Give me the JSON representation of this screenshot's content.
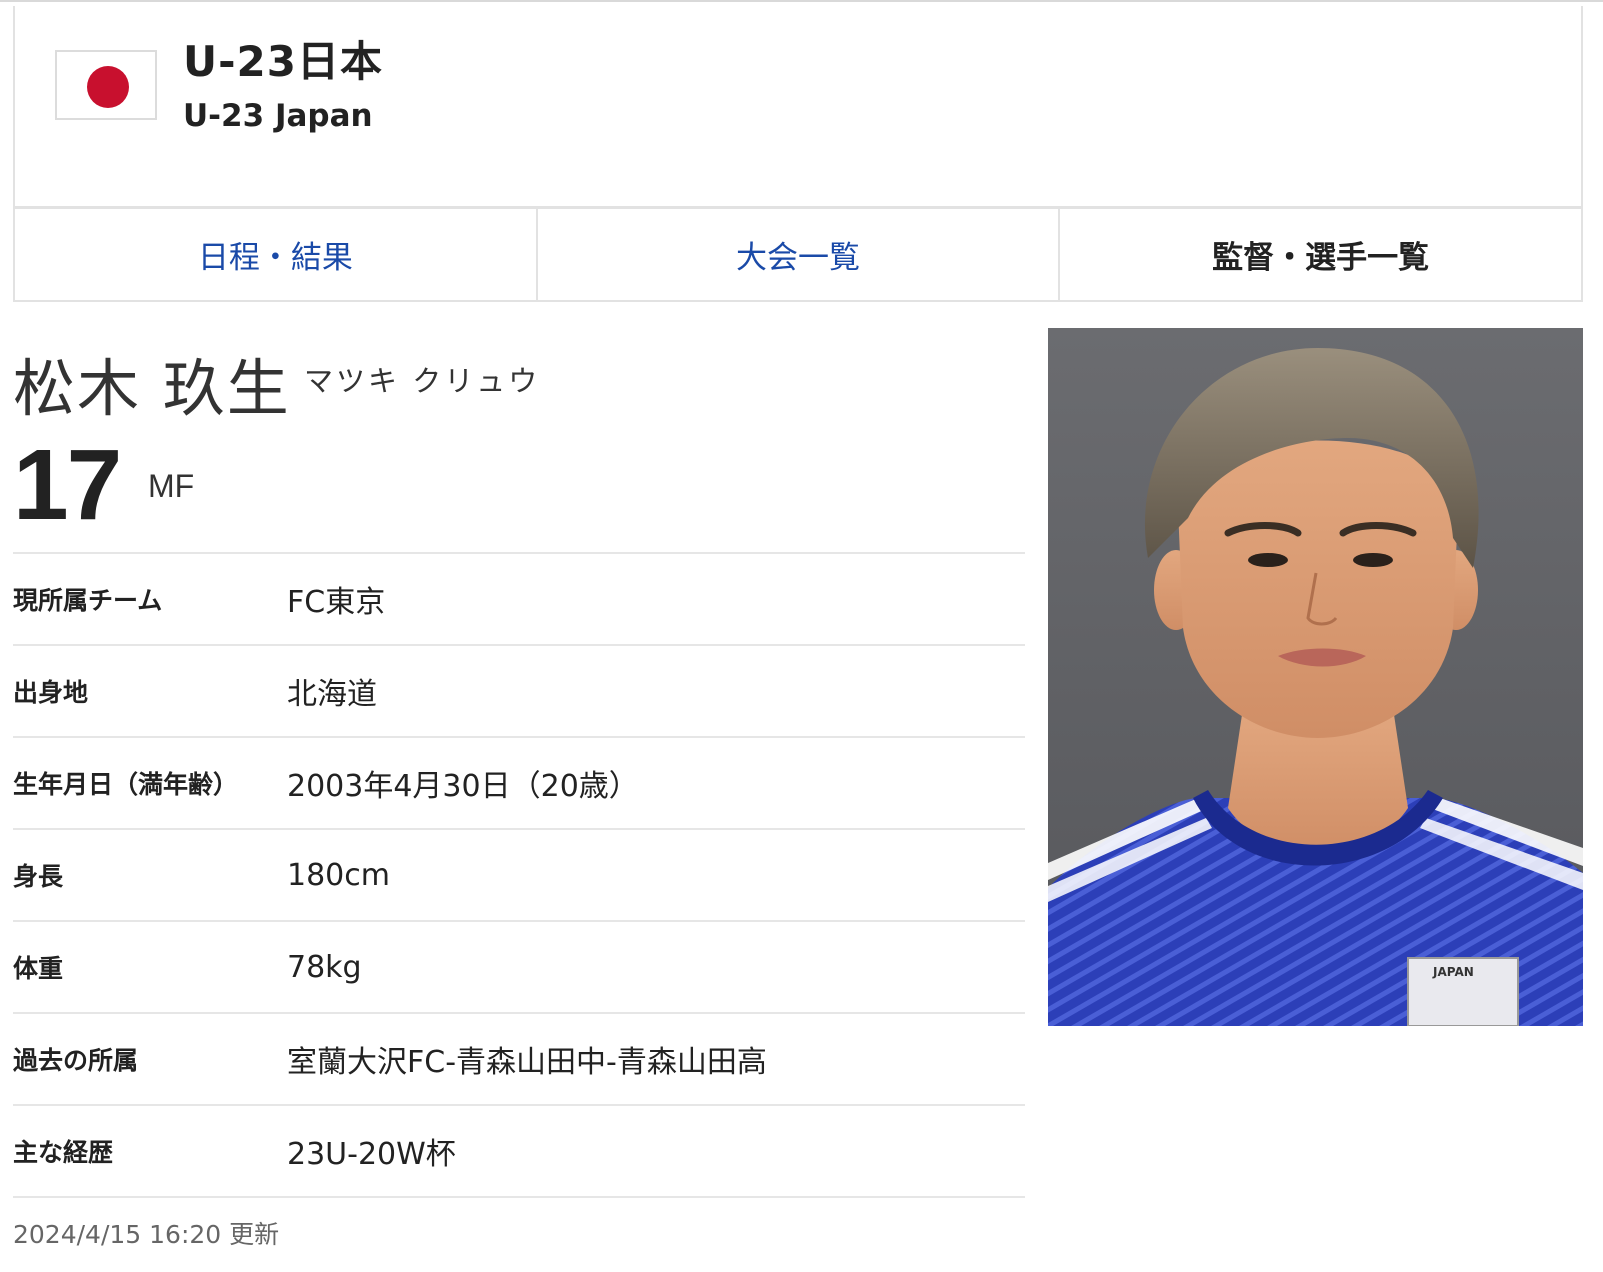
{
  "team": {
    "name_ja": "U-23日本",
    "name_en": "U-23 Japan",
    "flag_icon": "japan-flag-icon",
    "flag_color": "#c8102e"
  },
  "tabs": [
    {
      "label": "日程・結果",
      "active": false
    },
    {
      "label": "大会一覧",
      "active": false
    },
    {
      "label": "監督・選手一覧",
      "active": true
    }
  ],
  "player": {
    "name": "松木 玖生",
    "kana": "マツキ クリュウ",
    "number": "17",
    "position": "MF"
  },
  "profile": [
    {
      "label": "現所属チーム",
      "value": "FC東京"
    },
    {
      "label": "出身地",
      "value": "北海道"
    },
    {
      "label": "生年月日（満年齢）",
      "value": "2003年4月30日（20歳）"
    },
    {
      "label": "身長",
      "value": "180cm"
    },
    {
      "label": "体重",
      "value": "78kg"
    },
    {
      "label": "過去の所属",
      "value": "室蘭大沢FC-青森山田中-青森山田高"
    },
    {
      "label": "主な経歴",
      "value": "23U-20W杯"
    }
  ],
  "updated": "2024/4/15 16:20 更新",
  "photo": {
    "jersey_color": "#2c3fb8",
    "background_color": "#616266"
  }
}
